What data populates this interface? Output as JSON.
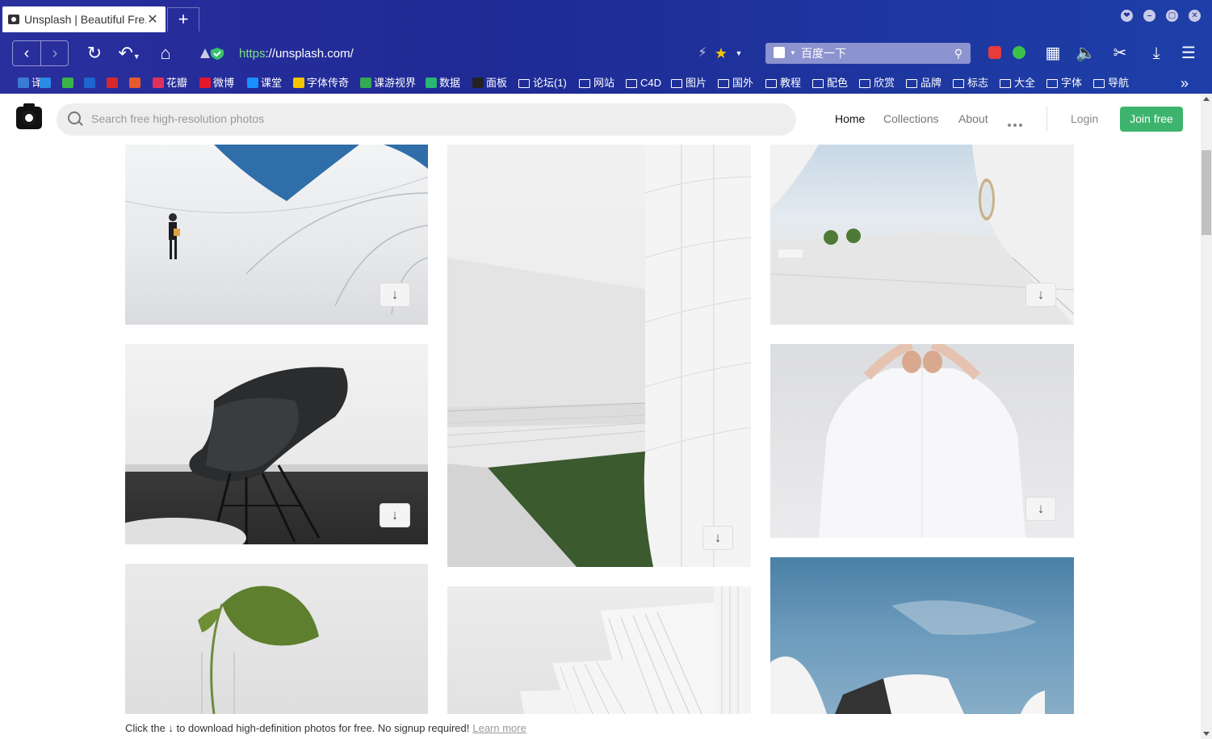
{
  "browser": {
    "tab_title": "Unsplash | Beautiful Fre...",
    "tab_close": "✕",
    "new_tab": "+",
    "url_scheme": "https",
    "url_rest": "://unsplash.com/",
    "search_engine_text": "百度一下",
    "window_buttons": [
      "❤",
      "–",
      "▢",
      "✕"
    ],
    "bookmarks": [
      {
        "label": "译",
        "kind": "icon",
        "color": "#3a7bd5"
      },
      {
        "label": "",
        "kind": "icon",
        "color": "#2b8ae6"
      },
      {
        "label": "",
        "kind": "icon",
        "color": "#3ab54a"
      },
      {
        "label": "",
        "kind": "icon",
        "color": "#1e66d0"
      },
      {
        "label": "",
        "kind": "icon",
        "color": "#d62828"
      },
      {
        "label": "",
        "kind": "icon",
        "color": "#e65a2b"
      },
      {
        "label": "花瓣",
        "kind": "icon",
        "color": "#e0315b"
      },
      {
        "label": "微博",
        "kind": "icon",
        "color": "#e6162d"
      },
      {
        "label": "课堂",
        "kind": "icon",
        "color": "#1890ff"
      },
      {
        "label": "字体传奇",
        "kind": "icon",
        "color": "#f5c400"
      },
      {
        "label": "课游视界",
        "kind": "icon",
        "color": "#35a852"
      },
      {
        "label": "数据",
        "kind": "icon",
        "color": "#2bb673"
      },
      {
        "label": "面板",
        "kind": "icon",
        "color": "#222222"
      },
      {
        "label": "论坛(1)",
        "kind": "folder"
      },
      {
        "label": "网站",
        "kind": "folder"
      },
      {
        "label": "C4D",
        "kind": "folder"
      },
      {
        "label": "图片",
        "kind": "folder"
      },
      {
        "label": "国外",
        "kind": "folder"
      },
      {
        "label": "教程",
        "kind": "folder"
      },
      {
        "label": "配色",
        "kind": "folder"
      },
      {
        "label": "欣赏",
        "kind": "folder"
      },
      {
        "label": "品牌",
        "kind": "folder"
      },
      {
        "label": "标志",
        "kind": "folder"
      },
      {
        "label": "大全",
        "kind": "folder"
      },
      {
        "label": "字体",
        "kind": "folder"
      },
      {
        "label": "导航",
        "kind": "folder"
      }
    ],
    "bookmark_more": "»"
  },
  "header": {
    "search_placeholder": "Search free high-resolution photos",
    "nav": [
      "Home",
      "Collections",
      "About"
    ],
    "login": "Login",
    "join": "Join free"
  },
  "photos": [
    {
      "subject": "white curved architecture with person",
      "download_icon": "↓"
    },
    {
      "subject": "black chair",
      "download_icon": "↓"
    },
    {
      "subject": "monstera leaf in glass vase",
      "download_icon": ""
    },
    {
      "subject": "white curved wall with grass",
      "download_icon": "↓"
    },
    {
      "subject": "white ribbed architecture",
      "download_icon": ""
    },
    {
      "subject": "white courtyard with round window",
      "download_icon": "↓"
    },
    {
      "subject": "man in white shirt",
      "download_icon": "↓"
    },
    {
      "subject": "blue sky and white building",
      "download_icon": ""
    }
  ],
  "footer": {
    "text": "Click the ↓ to download high-definition photos for free. No signup required!",
    "link": "Learn more"
  }
}
